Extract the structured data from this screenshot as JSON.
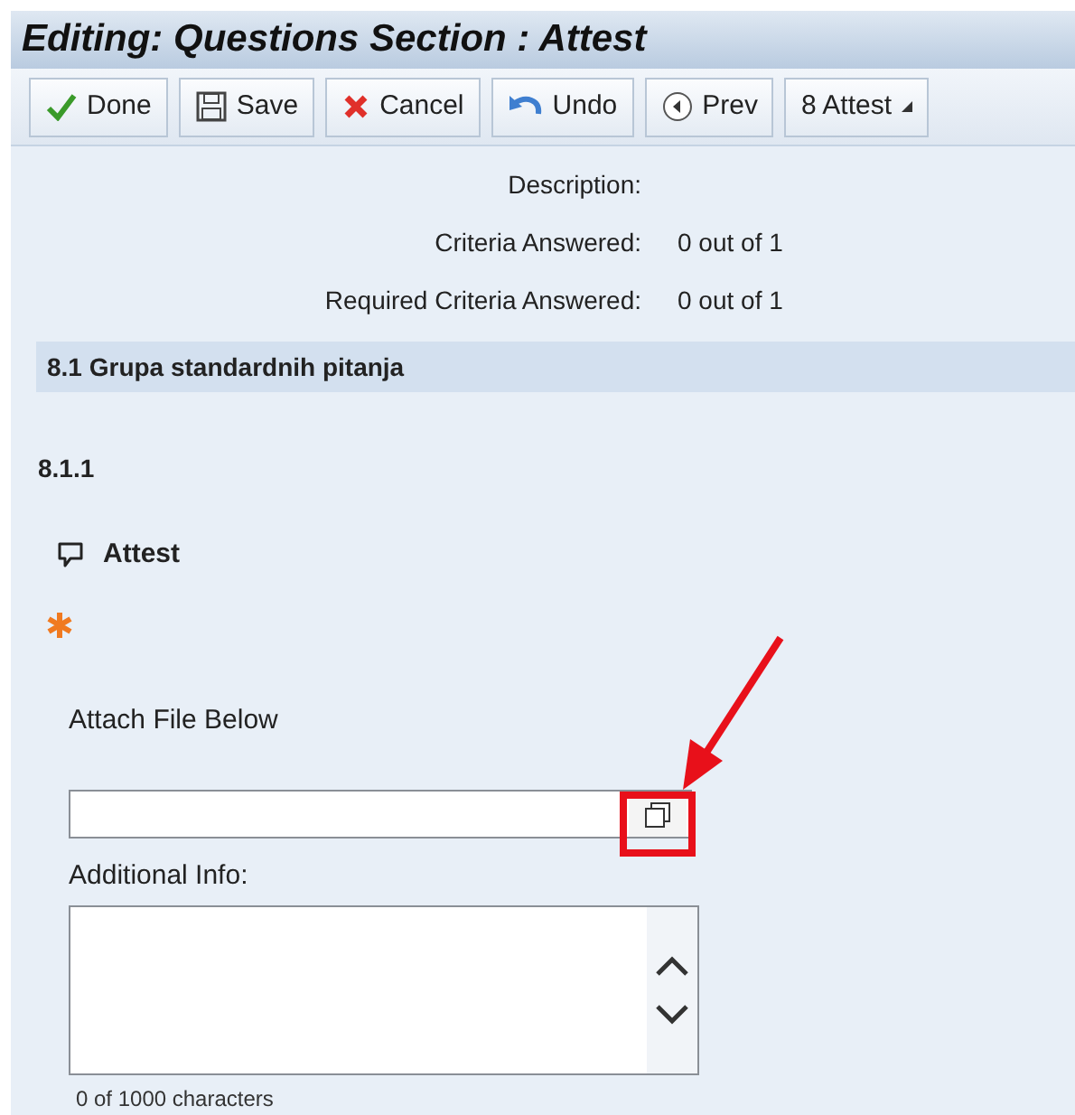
{
  "window": {
    "title": "Editing: Questions Section : Attest"
  },
  "toolbar": [
    {
      "kind": "done",
      "label": "Done"
    },
    {
      "kind": "save",
      "label": "Save"
    },
    {
      "kind": "cancel",
      "label": "Cancel"
    },
    {
      "kind": "undo",
      "label": "Undo"
    },
    {
      "kind": "prev",
      "label": "Prev"
    },
    {
      "kind": "menu",
      "label": "8 Attest"
    }
  ],
  "summary": [
    {
      "label": "Description:"
    },
    {
      "label": "Criteria Answered:",
      "value": "0 out of 1"
    },
    {
      "label": "Required Criteria Answered:",
      "value": "0 out of 1"
    }
  ],
  "section": {
    "title": "8.1 Grupa standardnih pitanja"
  },
  "question": {
    "number": "8.1.1",
    "title": "Attest",
    "required": true,
    "attach_label": "Attach File Below",
    "info_label": "Additional Info:",
    "counter": "0 of 1000 characters"
  }
}
